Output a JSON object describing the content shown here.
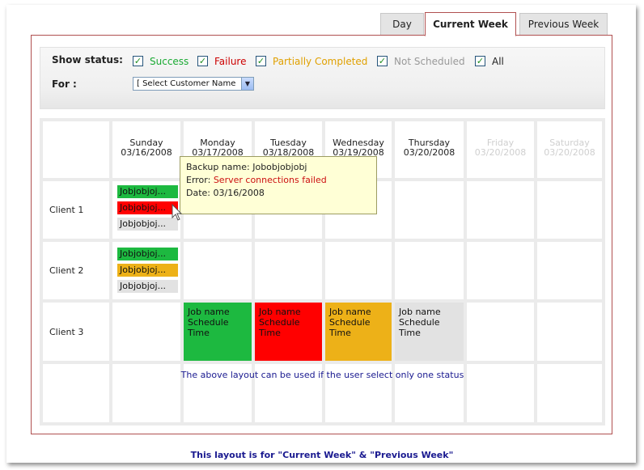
{
  "tabs": [
    {
      "label": "Day",
      "active": false
    },
    {
      "label": "Current Week",
      "active": true
    },
    {
      "label": "Previous Week",
      "active": false
    }
  ],
  "filters": {
    "show_status_label": "Show status:",
    "for_label": "For :",
    "statuses": [
      {
        "label": "Success",
        "checked": true,
        "color": "#1aaa33"
      },
      {
        "label": "Failure",
        "checked": true,
        "color": "#cc0000"
      },
      {
        "label": "Partially Completed",
        "checked": true,
        "color": "#e0a000"
      },
      {
        "label": "Not Scheduled",
        "checked": true,
        "color": "#999999"
      },
      {
        "label": "All",
        "checked": true,
        "color": "#222222"
      }
    ],
    "customer_select": "[ Select Customer Name"
  },
  "calendar": {
    "days": [
      {
        "name": "Sunday",
        "date": "03/16/2008",
        "dimmed": false
      },
      {
        "name": "Monday",
        "date": "03/17/2008",
        "dimmed": false
      },
      {
        "name": "Tuesday",
        "date": "03/18/2008",
        "dimmed": false
      },
      {
        "name": "Wednesday",
        "date": "03/19/2008",
        "dimmed": false
      },
      {
        "name": "Thursday",
        "date": "03/20/2008",
        "dimmed": false
      },
      {
        "name": "Friday",
        "date": "03/20/2008",
        "dimmed": true
      },
      {
        "name": "Saturday",
        "date": "03/20/2008",
        "dimmed": true
      }
    ],
    "clients": [
      {
        "name": "Client 1",
        "jobs": [
          {
            "label": "Jobjobjoj...",
            "status": "green"
          },
          {
            "label": "Jobjobjoj...",
            "status": "red"
          },
          {
            "label": "Jobjobjoj...",
            "status": "grey"
          }
        ]
      },
      {
        "name": "Client 2",
        "jobs": [
          {
            "label": "Jobjobjoj...",
            "status": "green"
          },
          {
            "label": "Jobjobjoj...",
            "status": "orange"
          },
          {
            "label": "Jobjobjoj...",
            "status": "grey"
          }
        ]
      },
      {
        "name": "Client 3",
        "weekly_jobs": [
          {
            "line1": "Job name",
            "line2": "Schedule",
            "line3": "Time",
            "status": "green"
          },
          {
            "line1": "Job name",
            "line2": "Schedule",
            "line3": "Time",
            "status": "red"
          },
          {
            "line1": "Job name",
            "line2": "Schedule",
            "line3": "Time",
            "status": "orange"
          },
          {
            "line1": "Job name",
            "line2": "Schedule",
            "line3": "Time",
            "status": "grey"
          }
        ]
      }
    ],
    "note": "The above layout can be used if the user select only one status"
  },
  "tooltip": {
    "backup_label": "Backup name:",
    "backup_value": "Jobobjobjobj",
    "error_label": "Error:",
    "error_value": "Server connections failed",
    "date_label": "Date:",
    "date_value": "03/16/2008"
  },
  "footer": "This layout is for \"Current Week\" & \"Previous Week\""
}
